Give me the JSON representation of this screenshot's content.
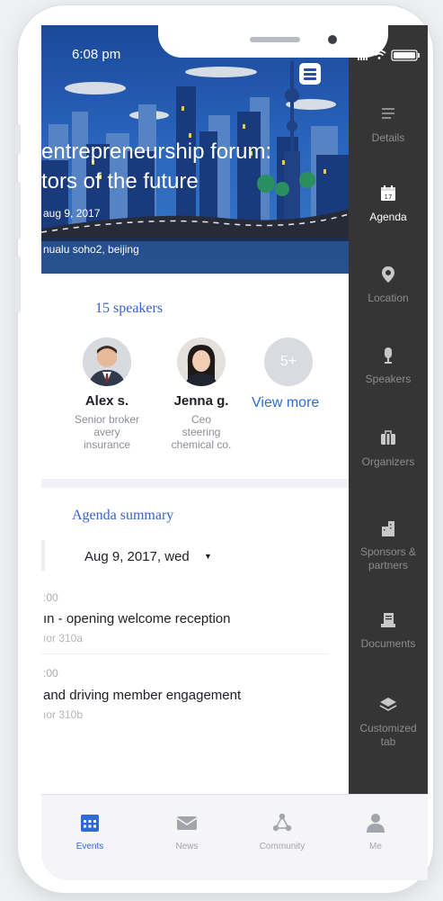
{
  "status_bar": {
    "time": "6:08 pm"
  },
  "event": {
    "title": "entrepreneurship forum: tors of the future",
    "title_line1": "entrepreneurship forum:",
    "title_line2": "tors of the future",
    "date": "aug 9, 2017",
    "location": "nualu soho2, beijing"
  },
  "speakers_section": {
    "title": "15 speakers",
    "speakers": [
      {
        "name": "Alex s.",
        "role_line1": "Senior broker",
        "role_line2": "avery",
        "role_line3": "insurance"
      },
      {
        "name": "Jenna g.",
        "role_line1": "Ceo",
        "role_line2": "steering",
        "role_line3": "chemical co."
      }
    ],
    "more_count": "5+",
    "view_more_label": "View more"
  },
  "agenda_section": {
    "title": "Agenda summary",
    "date_selector": "Aug 9, 2017, wed",
    "items": [
      {
        "time": ":00",
        "title": "ın - opening welcome reception",
        "room": "ıor 310a"
      },
      {
        "time": ":00",
        "title": "and driving member engagement",
        "room": "ıor 310b"
      }
    ]
  },
  "side_menu": {
    "items": [
      {
        "label": "Details",
        "icon": "details-icon"
      },
      {
        "label": "Agenda",
        "icon": "calendar-icon",
        "calendar_day": "17"
      },
      {
        "label": "Location",
        "icon": "location-pin-icon"
      },
      {
        "label": "Speakers",
        "icon": "microphone-icon"
      },
      {
        "label": "Organizers",
        "icon": "briefcase-icon"
      },
      {
        "label": "Sponsors & partners",
        "label_line1": "Sponsors &",
        "label_line2": "partners",
        "icon": "buildings-icon"
      },
      {
        "label": "Documents",
        "icon": "documents-icon"
      },
      {
        "label": "Customized tab",
        "label_line1": "Customized",
        "label_line2": "tab",
        "icon": "layers-icon"
      }
    ],
    "active": "Agenda"
  },
  "tab_bar": {
    "tabs": [
      {
        "label": "Events",
        "icon": "calendar-grid-icon"
      },
      {
        "label": "News",
        "icon": "envelope-icon"
      },
      {
        "label": "Community",
        "icon": "network-icon"
      },
      {
        "label": "Me",
        "icon": "person-icon"
      }
    ],
    "active": "Events"
  },
  "colors": {
    "accent": "#2f6bd8",
    "section_title": "#3a63c8",
    "side_panel": "#353535",
    "hero_blue": "#2d6ccc"
  }
}
